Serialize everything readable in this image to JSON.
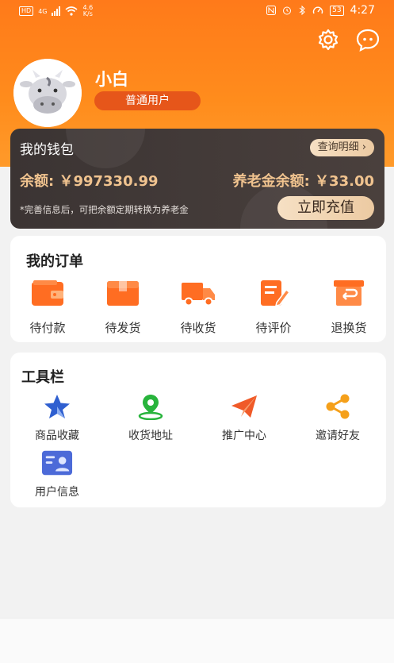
{
  "status_bar": {
    "hd": "HD",
    "net": "4G",
    "speed_top": "4.6",
    "speed_bottom": "K/s",
    "battery": "53",
    "time": "4:27"
  },
  "header": {
    "icons": [
      "settings-icon",
      "message-icon"
    ]
  },
  "profile": {
    "name": "小白",
    "level": "普通用户"
  },
  "wallet": {
    "title": "我的钱包",
    "detail_button": "查询明细 ›",
    "balance_text": "余额: ￥997330.99",
    "pension_text": "养老金余额: ￥33.00",
    "tip": "*完善信息后，可把余额定期转换为养老金",
    "topup_button": "立即充值",
    "colors": {
      "gold": "#f0c38f",
      "dark": "#3b3433"
    }
  },
  "orders": {
    "title": "我的订单",
    "items": [
      {
        "label": "待付款",
        "icon": "wallet-icon"
      },
      {
        "label": "待发货",
        "icon": "box-icon"
      },
      {
        "label": "待收货",
        "icon": "truck-icon"
      },
      {
        "label": "待评价",
        "icon": "review-icon"
      },
      {
        "label": "退换货",
        "icon": "return-icon"
      }
    ],
    "accent": "#ff6d22"
  },
  "tools": {
    "title": "工具栏",
    "items": [
      {
        "label": "商品收藏",
        "icon": "star-icon"
      },
      {
        "label": "收货地址",
        "icon": "location-icon"
      },
      {
        "label": "推广中心",
        "icon": "send-icon"
      },
      {
        "label": "邀请好友",
        "icon": "share-icon"
      },
      {
        "label": "用户信息",
        "icon": "user-card-icon"
      }
    ]
  }
}
